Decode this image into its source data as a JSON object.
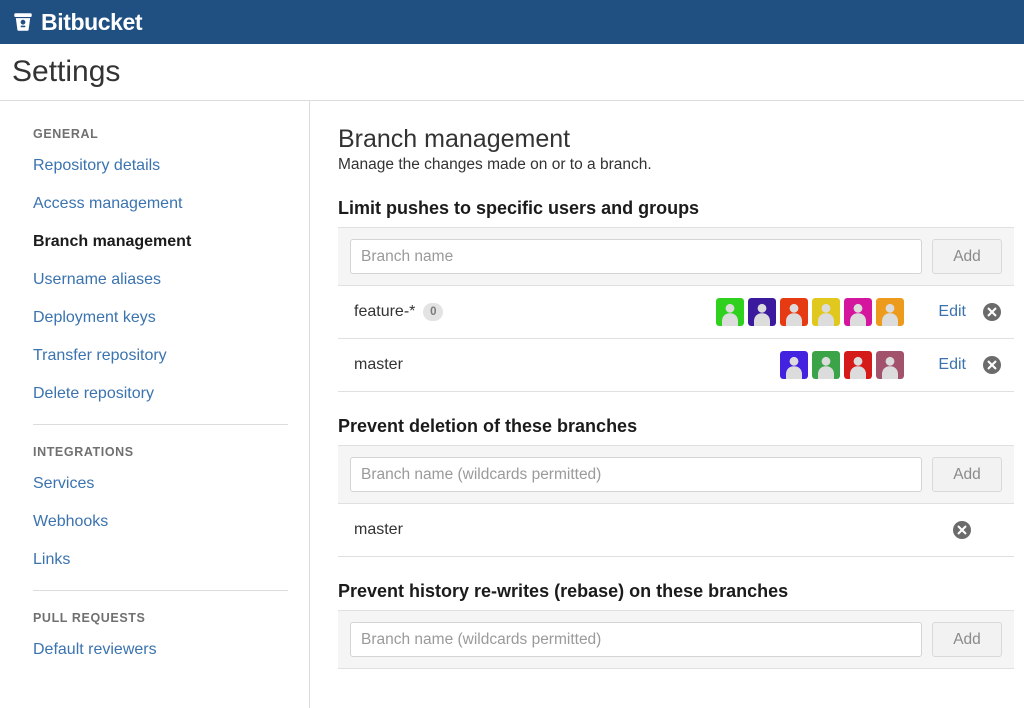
{
  "topbar": {
    "brand": "Bitbucket",
    "logo_icon": "bitbucket-bucket-icon"
  },
  "header": {
    "title": "Settings"
  },
  "sidebar": {
    "groups": [
      {
        "title": "GENERAL",
        "items": [
          {
            "label": "Repository details",
            "active": false
          },
          {
            "label": "Access management",
            "active": false
          },
          {
            "label": "Branch management",
            "active": true
          },
          {
            "label": "Username aliases",
            "active": false
          },
          {
            "label": "Deployment keys",
            "active": false
          },
          {
            "label": "Transfer repository",
            "active": false
          },
          {
            "label": "Delete repository",
            "active": false
          }
        ]
      },
      {
        "title": "INTEGRATIONS",
        "items": [
          {
            "label": "Services",
            "active": false
          },
          {
            "label": "Webhooks",
            "active": false
          },
          {
            "label": "Links",
            "active": false
          }
        ]
      },
      {
        "title": "PULL REQUESTS",
        "items": [
          {
            "label": "Default reviewers",
            "active": false
          }
        ]
      }
    ]
  },
  "main": {
    "page_title": "Branch management",
    "page_subtitle": "Manage the changes made on or to a branch.",
    "sections": [
      {
        "heading": "Limit pushes to specific users and groups",
        "add_row": {
          "placeholder": "Branch name",
          "value": "",
          "button_label": "Add"
        },
        "entries": [
          {
            "name": "feature-*",
            "badge": "0",
            "edit_label": "Edit",
            "avatars": [
              "#2fd01e",
              "#3b1a9e",
              "#e63b12",
              "#e0c81e",
              "#d4169e",
              "#ed9b1c"
            ]
          },
          {
            "name": "master",
            "badge": null,
            "edit_label": "Edit",
            "avatars": [
              "#4322e0",
              "#3ba348",
              "#d51a1a",
              "#a3526b"
            ]
          }
        ]
      },
      {
        "heading": "Prevent deletion of these branches",
        "add_row": {
          "placeholder": "Branch name (wildcards permitted)",
          "value": "",
          "button_label": "Add"
        },
        "entries": [
          {
            "name": "master",
            "badge": null,
            "edit_label": null,
            "avatars": []
          }
        ]
      },
      {
        "heading": "Prevent history re-writes (rebase) on these branches",
        "add_row": {
          "placeholder": "Branch name (wildcards permitted)",
          "value": "",
          "button_label": "Add"
        },
        "entries": []
      }
    ]
  },
  "colors": {
    "topbar_blue": "#205081",
    "link_blue": "#3b73af",
    "panel_gray": "#f5f5f5",
    "border_gray": "#e0e0e0",
    "delete_icon_gray": "#6b6b6b"
  },
  "icons": {
    "delete": "circle-x-icon",
    "avatar": "user-avatar-icon"
  }
}
